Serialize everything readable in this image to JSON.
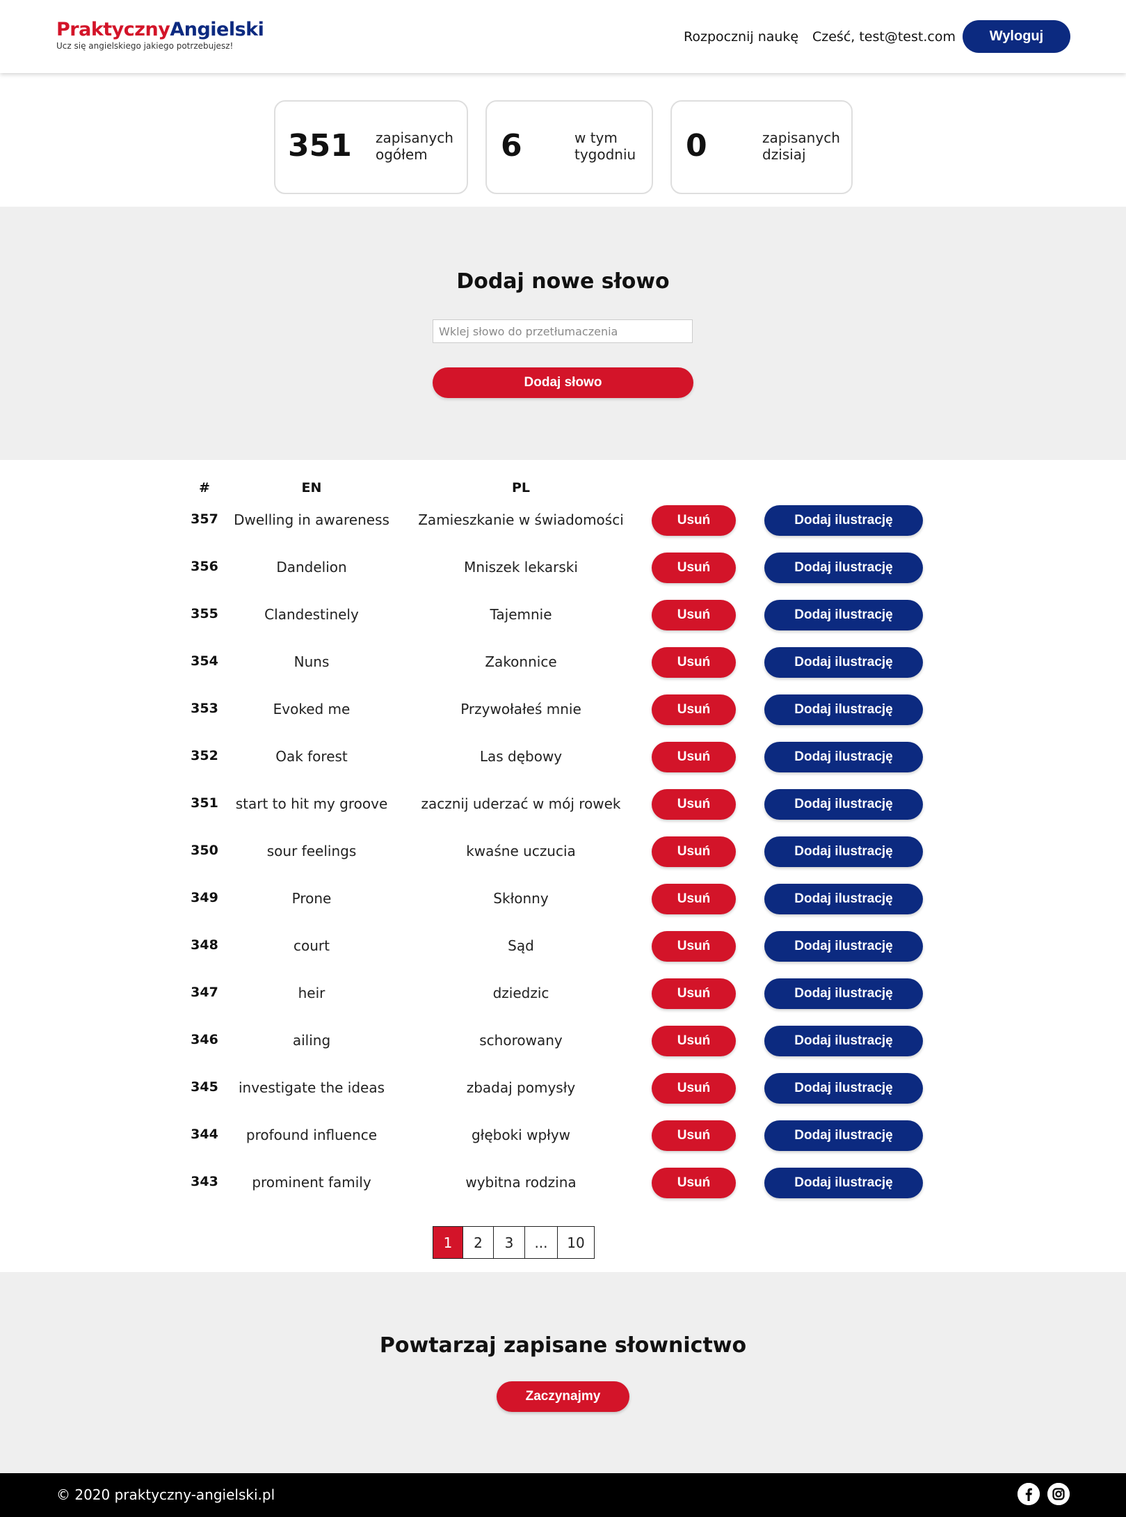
{
  "header": {
    "logo_part1": "Praktyczny",
    "logo_part2": "Angielski",
    "tagline": "Ucz się angielskiego jakiego potrzebujesz!",
    "nav_start": "Rozpocznij naukę",
    "greeting": "Cześć, test@test.com",
    "logout_label": "Wyloguj"
  },
  "stats": [
    {
      "value": "351",
      "label_line1": "zapisanych",
      "label_line2": "ogółem"
    },
    {
      "value": "6",
      "label_line1": "w tym",
      "label_line2": "tygodniu"
    },
    {
      "value": "0",
      "label_line1": "zapisanych",
      "label_line2": "dzisiaj"
    }
  ],
  "add_word": {
    "title": "Dodaj nowe słowo",
    "input_placeholder": "Wklej słowo do przetłumaczenia",
    "input_value": "",
    "button_label": "Dodaj słowo"
  },
  "table": {
    "headers": {
      "num": "#",
      "en": "EN",
      "pl": "PL"
    },
    "delete_label": "Usuń",
    "illustration_label": "Dodaj ilustrację",
    "rows": [
      {
        "num": "357",
        "en": "Dwelling in awareness",
        "pl": "Zamieszkanie w świadomości"
      },
      {
        "num": "356",
        "en": "Dandelion",
        "pl": "Mniszek lekarski"
      },
      {
        "num": "355",
        "en": "Clandestinely",
        "pl": "Tajemnie"
      },
      {
        "num": "354",
        "en": "Nuns",
        "pl": "Zakonnice"
      },
      {
        "num": "353",
        "en": "Evoked me",
        "pl": "Przywołałeś mnie"
      },
      {
        "num": "352",
        "en": "Oak forest",
        "pl": "Las dębowy"
      },
      {
        "num": "351",
        "en": "start to hit my groove",
        "pl": "zacznij uderzać w mój rowek"
      },
      {
        "num": "350",
        "en": "sour feelings",
        "pl": "kwaśne uczucia"
      },
      {
        "num": "349",
        "en": "Prone",
        "pl": "Skłonny"
      },
      {
        "num": "348",
        "en": "court",
        "pl": "Sąd"
      },
      {
        "num": "347",
        "en": "heir",
        "pl": "dziedzic"
      },
      {
        "num": "346",
        "en": "ailing",
        "pl": "schorowany"
      },
      {
        "num": "345",
        "en": "investigate the ideas",
        "pl": "zbadaj pomysły"
      },
      {
        "num": "344",
        "en": "profound influence",
        "pl": "głęboki wpływ"
      },
      {
        "num": "343",
        "en": "prominent family",
        "pl": "wybitna rodzina"
      }
    ]
  },
  "pagination": {
    "pages": [
      "1",
      "2",
      "3",
      "...",
      "10"
    ],
    "current": "1"
  },
  "review": {
    "title": "Powtarzaj zapisane słownictwo",
    "button_label": "Zaczynajmy"
  },
  "footer": {
    "copyright": "© 2020 praktyczny-angielski.pl",
    "social_icons": [
      "facebook-icon",
      "instagram-icon"
    ]
  },
  "colors": {
    "brand_red": "#d31429",
    "brand_blue": "#0c2a80",
    "section_gray": "#efefef",
    "footer_black": "#000000"
  }
}
